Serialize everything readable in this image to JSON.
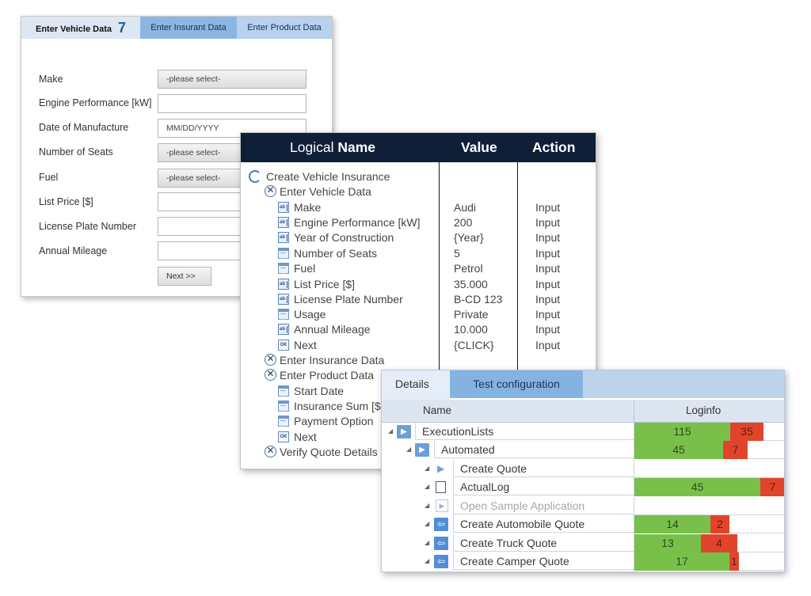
{
  "form": {
    "tabs": {
      "vehicle": "Enter Vehicle Data",
      "vehicle_count": "7",
      "insurant": "Enter Insurant Data",
      "product": "Enter Product Data"
    },
    "fields": [
      {
        "label": "Make",
        "value": "-please select-"
      },
      {
        "label": "Engine Performance [kW]",
        "value": ""
      },
      {
        "label": "Date of Manufacture",
        "value": "MM/DD/YYYY"
      },
      {
        "label": "Number of Seats",
        "value": "-please select-"
      },
      {
        "label": "Fuel",
        "value": "-please select-"
      },
      {
        "label": "List Price [$]",
        "value": ""
      },
      {
        "label": "License Plate Number",
        "value": ""
      },
      {
        "label": "Annual Mileage",
        "value": ""
      }
    ],
    "next_label": "Next >>"
  },
  "tree": {
    "header": {
      "logical": "Logical ",
      "name": "Name",
      "value": "Value",
      "action": "Action"
    },
    "rows": [
      {
        "name": "Create Vehicle Insurance",
        "value": "",
        "action": "",
        "icon": "refresh-icon"
      },
      {
        "name": "Enter Vehicle Data",
        "value": "",
        "action": "",
        "icon": "module-x-icon"
      },
      {
        "name": "Make",
        "value": "Audi",
        "action": "Input",
        "icon": "textbox-icon"
      },
      {
        "name": "Engine Performance [kW]",
        "value": "200",
        "action": "Input",
        "icon": "textbox-icon"
      },
      {
        "name": "Year of Construction",
        "value": "{Year}",
        "action": "Input",
        "icon": "textbox-icon"
      },
      {
        "name": "Number of Seats",
        "value": "5",
        "action": "Input",
        "icon": "listbox-icon"
      },
      {
        "name": "Fuel",
        "value": "Petrol",
        "action": "Input",
        "icon": "listbox-icon"
      },
      {
        "name": "List Price [$]",
        "value": "35.000",
        "action": "Input",
        "icon": "textbox-icon"
      },
      {
        "name": "License Plate Number",
        "value": "B-CD 123",
        "action": "Input",
        "icon": "textbox-icon"
      },
      {
        "name": "Usage",
        "value": "Private",
        "action": "Input",
        "icon": "listbox-icon"
      },
      {
        "name": "Annual Mileage",
        "value": "10.000",
        "action": "Input",
        "icon": "textbox-icon"
      },
      {
        "name": "Next",
        "value": "{CLICK}",
        "action": "Input",
        "icon": "ok-button-icon"
      },
      {
        "name": "Enter Insurance Data",
        "value": "",
        "action": "",
        "icon": "module-x-icon"
      },
      {
        "name": "Enter Product Data",
        "value": "",
        "action": "",
        "icon": "module-x-icon"
      },
      {
        "name": "Start Date",
        "value": "",
        "action": "",
        "icon": "listbox-icon"
      },
      {
        "name": "Insurance Sum [$",
        "value": "",
        "action": "",
        "icon": "listbox-icon"
      },
      {
        "name": "Payment Option",
        "value": "",
        "action": "",
        "icon": "listbox-icon"
      },
      {
        "name": "Next",
        "value": "",
        "action": "",
        "icon": "ok-button-icon"
      },
      {
        "name": "Verify Quote Details",
        "value": "",
        "action": "",
        "icon": "module-x-icon"
      }
    ]
  },
  "exec": {
    "tabs": {
      "details": "Details",
      "test_config": "Test configuration"
    },
    "columns": {
      "name": "Name",
      "loginfo": "Loginfo"
    },
    "rows": [
      {
        "name": "ExecutionLists",
        "passed": "115",
        "failed": "35",
        "icon": "execution-list-icon"
      },
      {
        "name": "Automated",
        "passed": "45",
        "failed": "7",
        "icon": "execution-list-icon"
      },
      {
        "name": "Create Quote",
        "passed": "",
        "failed": "",
        "icon": "play-arrow-icon"
      },
      {
        "name": "ActualLog",
        "passed": "45",
        "failed": "7",
        "icon": "log-icon"
      },
      {
        "name": "Open Sample Application",
        "passed": "",
        "failed": "",
        "icon": "disabled-play-icon"
      },
      {
        "name": "Create Automobile Quote",
        "passed": "14",
        "failed": "2",
        "icon": "testcase-icon"
      },
      {
        "name": "Create Truck Quote",
        "passed": "13",
        "failed": "4",
        "icon": "testcase-icon"
      },
      {
        "name": "Create Camper Quote",
        "passed": "17",
        "failed": "1",
        "icon": "testcase-icon"
      }
    ]
  },
  "colors": {
    "header_navy": "#0f1f38",
    "tab_blue": "#8cb6e2",
    "pass_green": "#78c04a",
    "fail_red": "#e0452c"
  }
}
